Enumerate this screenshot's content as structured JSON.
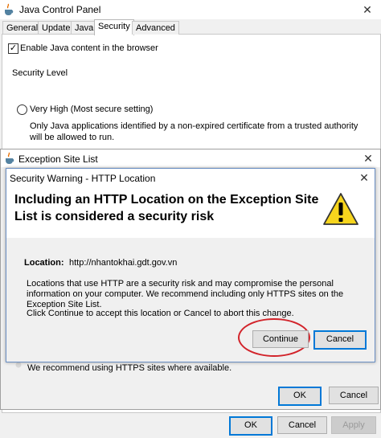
{
  "jcp": {
    "title": "Java Control Panel",
    "close_glyph": "✕",
    "tabs": [
      {
        "label": "General",
        "active": false
      },
      {
        "label": "Update",
        "active": false
      },
      {
        "label": "Java",
        "active": false
      },
      {
        "label": "Security",
        "active": true
      },
      {
        "label": "Advanced",
        "active": false
      }
    ],
    "enable_java_label": "Enable Java content in the browser",
    "enable_java_checked": true,
    "security_level_label": "Security Level",
    "very_high_label": "Very High (Most secure setting)",
    "very_high_desc": "Only Java applications identified by a non-expired certificate from a trusted authority will be allowed to run.",
    "ok_label": "OK",
    "cancel_label": "Cancel",
    "apply_label": "Apply"
  },
  "esl": {
    "title": "Exception Site List",
    "close_glyph": "✕",
    "https_note": "We recommend using HTTPS sites where available.",
    "ok_label": "OK",
    "cancel_label": "Cancel"
  },
  "warning": {
    "title": "Security Warning - HTTP Location",
    "close_glyph": "✕",
    "heading": "Including an HTTP Location on the Exception Site List is considered a security risk",
    "location_label": "Location:",
    "location_value": "http://nhantokhai.gdt.gov.vn",
    "risk_text": "Locations that use HTTP are a security risk and may compromise the personal information on your computer.  We recommend including only HTTPS sites on the Exception Site List.",
    "continue_text": "Click Continue to accept this location or Cancel to abort this change.",
    "continue_label": "Continue",
    "cancel_label": "Cancel",
    "warning_icon": "warning-triangle-icon"
  },
  "colors": {
    "accent": "#0078d7",
    "highlight_circle": "#d2232a",
    "warning_yellow": "#f7d51d"
  }
}
